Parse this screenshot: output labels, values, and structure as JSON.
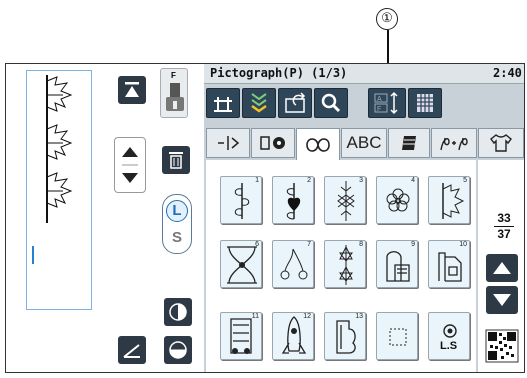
{
  "callout": {
    "label": "①"
  },
  "header": {
    "title": "Pictograph(P) (1/3)",
    "time": "2:40"
  },
  "toolbar": {
    "buttons": [
      {
        "name": "mirror-image-button",
        "icon": "mirror-icon"
      },
      {
        "name": "heart-pattern-button",
        "icon": "heart-pattern-icon"
      },
      {
        "name": "folder-open-button",
        "icon": "folder-open-icon"
      },
      {
        "name": "magnify-button",
        "icon": "magnify-icon"
      },
      {
        "name": "alphabet-spacing-button",
        "icon": "text-size-icon"
      },
      {
        "name": "memory-grid-button",
        "icon": "grid-icon"
      }
    ]
  },
  "tabs": [
    {
      "name": "tab-utility",
      "label": "",
      "icon": "utility-stitch-icon"
    },
    {
      "name": "tab-buttonhole",
      "label": "",
      "icon": "buttonhole-icon"
    },
    {
      "name": "tab-decorative",
      "label": "",
      "icon": "decorative-icon",
      "active": true
    },
    {
      "name": "tab-alphabet",
      "label": "ABC"
    },
    {
      "name": "tab-satin",
      "label": "",
      "icon": "satin-icon"
    },
    {
      "name": "tab-combination",
      "label": "",
      "icon": "combination-icon"
    },
    {
      "name": "tab-garment",
      "label": "",
      "icon": "shirt-icon"
    }
  ],
  "patterns": [
    {
      "num": "1"
    },
    {
      "num": "2"
    },
    {
      "num": "3"
    },
    {
      "num": "4"
    },
    {
      "num": "5"
    },
    {
      "num": "6"
    },
    {
      "num": "7"
    },
    {
      "num": "8"
    },
    {
      "num": "9"
    },
    {
      "num": "10"
    },
    {
      "num": "11"
    },
    {
      "num": "12"
    },
    {
      "num": "13"
    },
    {
      "num": ""
    },
    {
      "num": ""
    }
  ],
  "pattern_extra": {
    "ls_label": "L.S"
  },
  "pager": {
    "current": "33",
    "total": "37"
  },
  "left_panel": {
    "foot_label": "F",
    "size_large": "L",
    "size_small": "S"
  },
  "colors": {
    "accent": "#1f6fb5",
    "toolbar": "#2e4658",
    "panel": "#c9d1d8"
  }
}
